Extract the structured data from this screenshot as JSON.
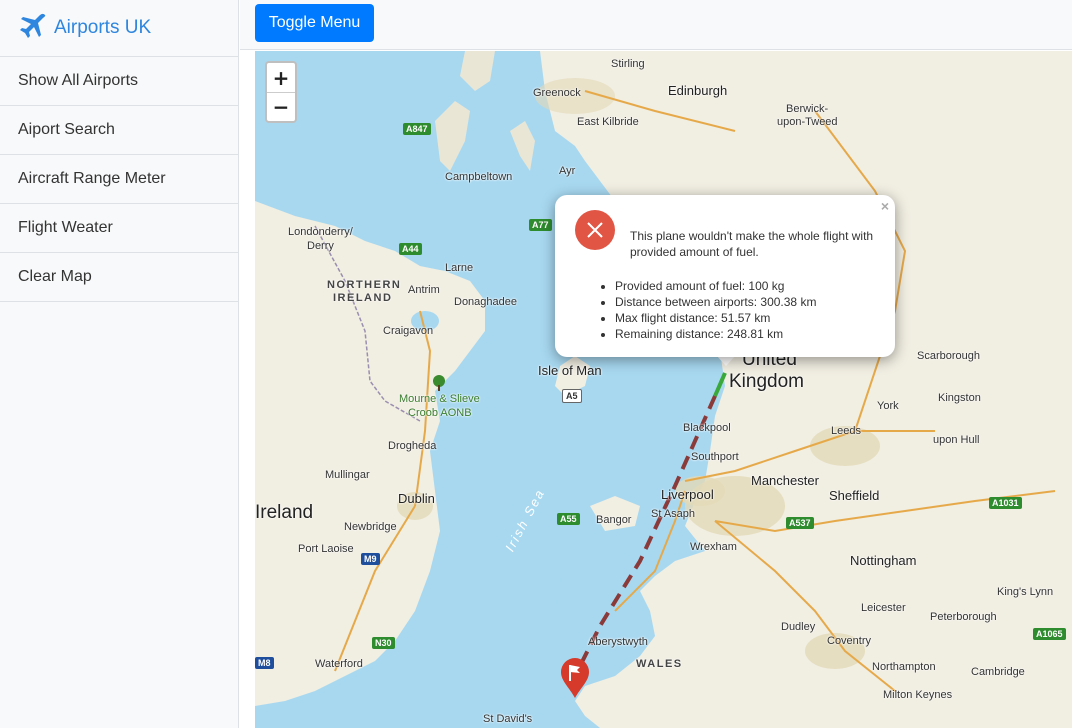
{
  "sidebar": {
    "brand": "Airports UK",
    "items": [
      {
        "label": "Show All Airports"
      },
      {
        "label": "Aiport Search"
      },
      {
        "label": "Aircraft Range Meter"
      },
      {
        "label": "Flight Weater"
      },
      {
        "label": "Clear Map"
      }
    ]
  },
  "topbar": {
    "toggle_label": "Toggle Menu"
  },
  "map": {
    "zoom_in": "+",
    "zoom_out": "−",
    "places": {
      "stirling": "Stirling",
      "greenock": "Greenock",
      "edinburgh": "Edinburgh",
      "berwick": "Berwick-",
      "berwick2": "upon-Tweed",
      "east_kilbride": "East Kilbride",
      "campbeltown": "Campbeltown",
      "ayr": "Ayr",
      "londonderry": "Londonderry/",
      "derry": "Derry",
      "northern": "NORTHERN",
      "ireland_ni": "IRELAND",
      "larne": "Larne",
      "antrim": "Antrim",
      "donaghadee": "Donaghadee",
      "craigavon": "Craigavon",
      "mourne": "Mourne & Slieve",
      "mourne2": "Croob AONB",
      "isle_of_man": "Isle of Man",
      "united": "United",
      "kingdom": "Kingdom",
      "scarborough": "Scarborough",
      "york": "York",
      "kingston": "Kingston",
      "kingston2": "upon Hull",
      "leeds": "Leeds",
      "blackpool": "Blackpool",
      "southport": "Southport",
      "drogheda": "Drogheda",
      "manchester": "Manchester",
      "sheffield": "Sheffield",
      "mullingar": "Mullingar",
      "dublin": "Dublin",
      "liverpool": "Liverpool",
      "st_asaph": "St Asaph",
      "bangor": "Bangor",
      "ireland": "Ireland",
      "newbridge": "Newbridge",
      "wrexham": "Wrexham",
      "port_laoise": "Port Laoise",
      "nottingham": "Nottingham",
      "kings_lynn": "King's Lynn",
      "leicester": "Leicester",
      "peterborough": "Peterborough",
      "dudley": "Dudley",
      "coventry": "Coventry",
      "aberystwyth": "Aberystwyth",
      "wales": "WALES",
      "waterford": "Waterford",
      "northampton": "Northampton",
      "cambridge": "Cambridge",
      "milton_keynes": "Milton Keynes",
      "st_davids": "St David's",
      "irish_sea": "Irish Sea"
    },
    "roads": {
      "a847": "A847",
      "a44": "A44",
      "a77": "A77",
      "a5": "A5",
      "a55": "A55",
      "m9": "M9",
      "n30": "N30",
      "m8": "M8",
      "a537": "A537",
      "a1031": "A1031",
      "a1065": "A1065"
    }
  },
  "popup": {
    "close": "×",
    "message": "This plane wouldn't make the whole flight with provided amount of fuel.",
    "details": [
      "Provided amount of fuel: 100 kg",
      "Distance between airports: 300.38 km",
      "Max flight distance: 51.57 km",
      "Remaining distance: 248.81 km"
    ]
  },
  "colors": {
    "brand": "#2e86de",
    "button": "#007bff",
    "error_icon": "#e05544",
    "flight_reached": "#3aa83a",
    "flight_remaining": "#8b3a3a",
    "marker": "#d63a2a"
  }
}
